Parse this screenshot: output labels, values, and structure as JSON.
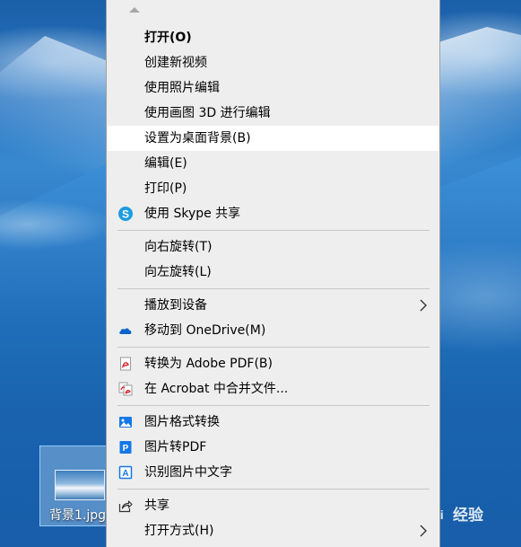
{
  "desktop": {
    "file_label": "背景1.jpg"
  },
  "menu": {
    "items": [
      {
        "label": "打开(O)",
        "bold": true
      },
      {
        "label": "创建新视频"
      },
      {
        "label": "使用照片编辑"
      },
      {
        "label": "使用画图 3D 进行编辑"
      },
      {
        "label": "设置为桌面背景(B)",
        "highlighted": true
      },
      {
        "label": "编辑(E)"
      },
      {
        "label": "打印(P)"
      },
      {
        "label": "使用 Skype 共享",
        "icon": "skype-icon"
      },
      {
        "label": "向右旋转(T)"
      },
      {
        "label": "向左旋转(L)"
      },
      {
        "label": "播放到设备",
        "submenu": true
      },
      {
        "label": "移动到 OneDrive(M)",
        "icon": "onedrive-icon"
      },
      {
        "label": "转换为 Adobe PDF(B)",
        "icon": "adobe-pdf-icon"
      },
      {
        "label": "在 Acrobat 中合并文件...",
        "icon": "acrobat-combine-icon"
      },
      {
        "label": "图片格式转换",
        "icon": "image-convert-icon"
      },
      {
        "label": "图片转PDF",
        "icon": "image-to-pdf-icon"
      },
      {
        "label": "识别图片中文字",
        "icon": "ocr-icon"
      },
      {
        "label": "共享",
        "icon": "share-icon"
      },
      {
        "label": "打开方式(H)",
        "submenu": true
      }
    ]
  },
  "watermark": {
    "text": "经验"
  },
  "colors": {
    "menu_bg": "#eeeeee",
    "highlight": "#ffffff",
    "skype_blue": "#1e9be0",
    "onedrive_blue": "#0a64c8",
    "adobe_red": "#d7262d",
    "app_blue": "#1478e6"
  }
}
